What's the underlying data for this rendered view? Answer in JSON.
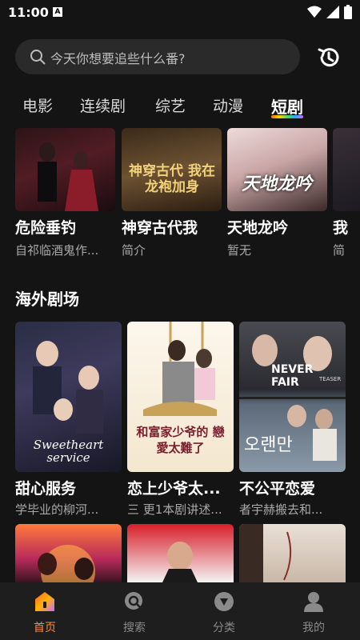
{
  "status": {
    "time": "11:00",
    "badge": "A"
  },
  "search": {
    "placeholder": "今天你想要追些什么番?"
  },
  "tabs": [
    {
      "label": "电影"
    },
    {
      "label": "连续剧"
    },
    {
      "label": "综艺"
    },
    {
      "label": "动漫"
    },
    {
      "label": "短剧",
      "active": true
    }
  ],
  "row1": [
    {
      "title": "危险垂钓",
      "subtitle": "自祁临酒鬼作..."
    },
    {
      "title": "神穿古代我",
      "subtitle": "简介",
      "poster_text": "神穿古代 我在龙袍加身"
    },
    {
      "title": "天地龙吟",
      "subtitle": "暂无",
      "poster_text": "天地龙吟"
    },
    {
      "title": "我",
      "subtitle": "简"
    }
  ],
  "section": {
    "title": "海外剧场"
  },
  "row2": [
    {
      "title": "甜心服务",
      "subtitle": "学毕业的柳河...",
      "poster_text": "Sweetheart service"
    },
    {
      "title": "恋上少爷太...",
      "subtitle": "三 更1本剧讲述...",
      "poster_text": "和富家少爷的 戀愛太難了"
    },
    {
      "title": "不公平恋爱",
      "subtitle": "者宇赫搬去和...",
      "poster_text": "NEVER FAIR",
      "poster_badge": "TEASER",
      "poster_text2": "오랜만"
    }
  ],
  "nav": [
    {
      "label": "首页",
      "icon": "home-icon",
      "active": true
    },
    {
      "label": "搜索",
      "icon": "search-icon"
    },
    {
      "label": "分类",
      "icon": "category-icon"
    },
    {
      "label": "我的",
      "icon": "profile-icon"
    }
  ],
  "colors": {
    "accent": "#ff8a3c",
    "background": "#141414",
    "nav_bg": "#1e1e1e"
  }
}
